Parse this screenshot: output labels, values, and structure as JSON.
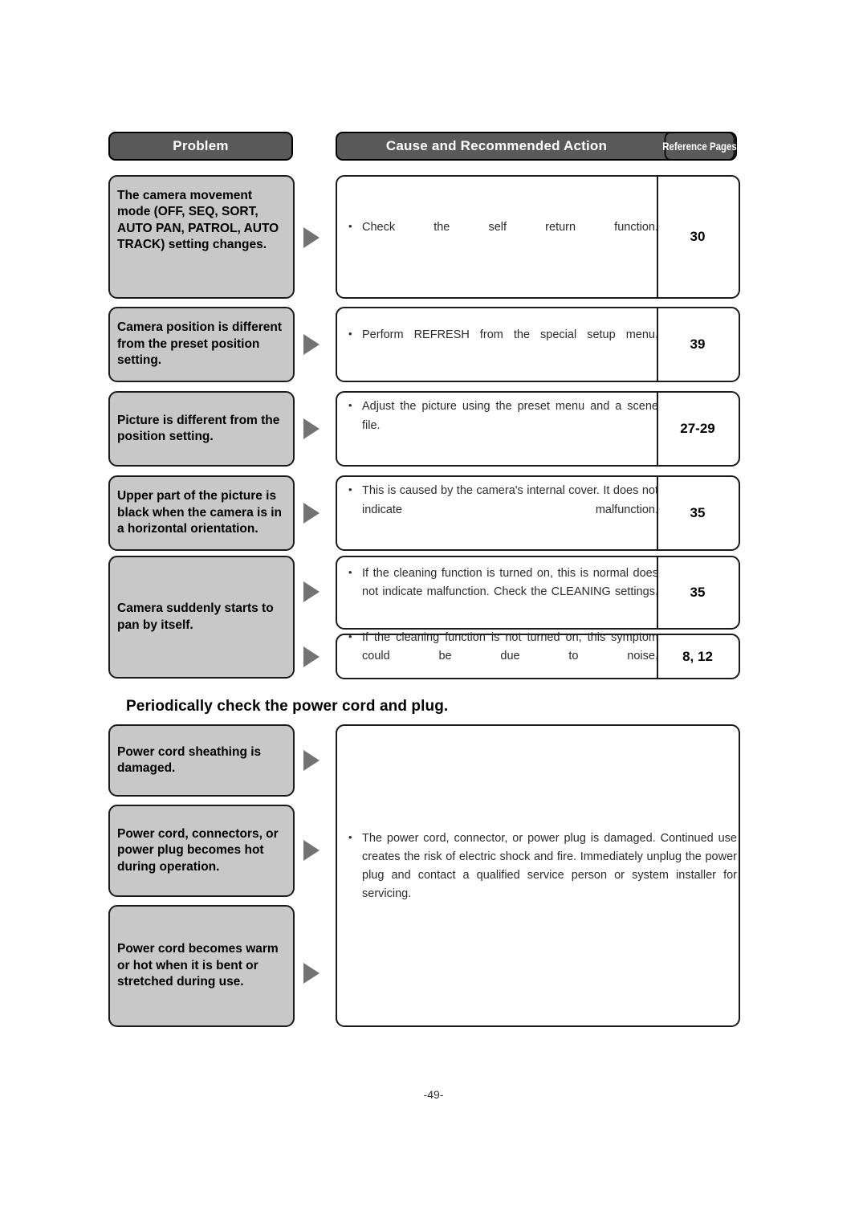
{
  "document": {
    "page_number": "-49-"
  },
  "table": {
    "headers": {
      "problem": "Problem",
      "cause": "Cause and Recommended Action",
      "reference": "Reference Pages"
    },
    "rows": [
      {
        "problem": "The camera movement mode (OFF, SEQ, SORT, AUTO PAN, PATROL, AUTO TRACK) setting changes.",
        "cause": "Check the self return function.",
        "reference": "30"
      },
      {
        "problem": "Camera position is different from the preset position setting.",
        "cause": "Perform REFRESH from the special setup menu.",
        "reference": "39"
      },
      {
        "problem": "Picture is different from the position setting.",
        "cause": "Adjust the picture using the preset menu and a scene file.",
        "reference": "27-29"
      },
      {
        "problem": "Upper part of the picture is black when the camera is in a horizontal orientation.",
        "cause": "This is caused by the camera's internal cover. It does not indicate malfunction.",
        "reference": "35"
      },
      {
        "problem": "Camera suddenly starts to pan by itself.",
        "cause": "If the cleaning function is turned on, this is normal does not indicate malfunction. Check the CLEANING settings.",
        "reference": "35"
      },
      {
        "problem": "",
        "cause": "If the cleaning function is not turned on, this symptom could be due to noise.",
        "reference": "8, 12"
      }
    ]
  },
  "power_section": {
    "title": "Periodically check the power cord and plug.",
    "problems": [
      "Power cord sheathing is damaged.",
      "Power cord, connectors, or power plug becomes hot during operation.",
      "Power cord becomes warm or hot when it is bent or stretched during use."
    ],
    "cause": "The power cord, connector, or power plug is damaged. Continued use creates the risk of electric shock and fire. Immediately unplug the power plug and contact a qualified service person or system installer for servicing."
  }
}
